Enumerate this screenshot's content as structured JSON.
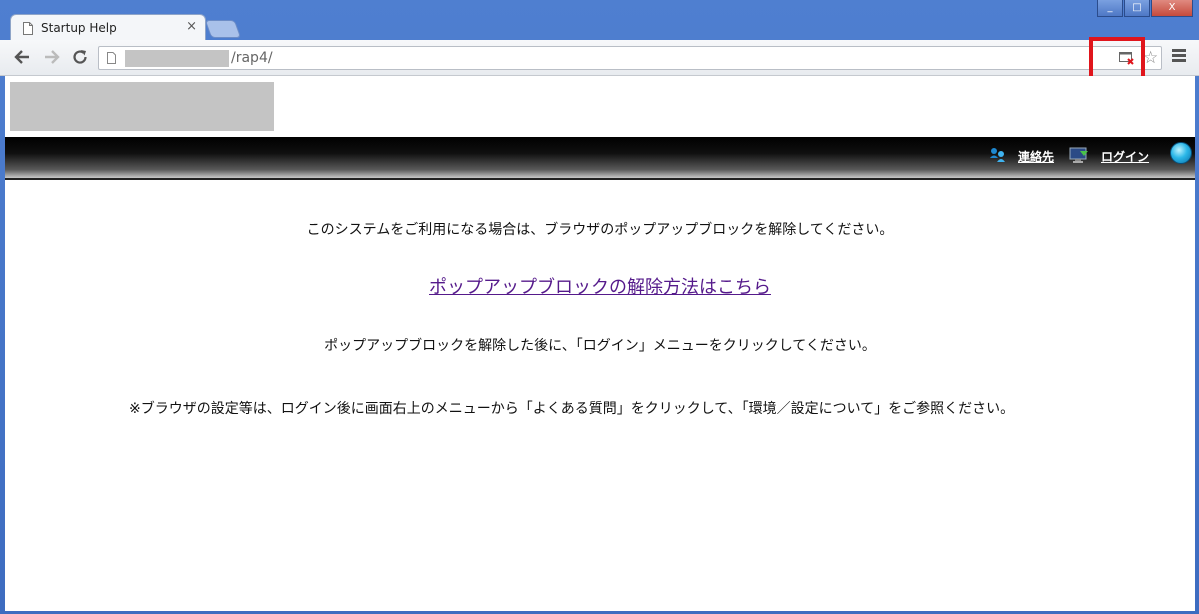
{
  "browser": {
    "tab_title": "Startup Help",
    "tab_close": "×",
    "window_controls": {
      "minimize": "_",
      "maximize": "□",
      "close": "X"
    },
    "address": {
      "visible_path": "/rap4/"
    },
    "icons": [
      "back-arrow-icon",
      "forward-arrow-icon",
      "reload-icon",
      "page-icon",
      "popup-blocked-icon",
      "bookmark-star-icon",
      "menu-icon"
    ]
  },
  "header": {
    "contact_label": "連絡先",
    "login_label": "ログイン"
  },
  "content": {
    "message_1": "このシステムをご利用になる場合は、ブラウザのポップアップブロックを解除してください。",
    "help_link": "ポップアップブロックの解除方法はこちら",
    "message_2": "ポップアップブロックを解除した後に、「ログイン」メニューをクリックしてください。",
    "note": "※ブラウザの設定等は、ログイン後に画面右上のメニューから「よくある質問」をクリックして、「環境／設定について」をご参照ください。"
  },
  "colors": {
    "highlight": "#e0151c",
    "link": "#551a8b",
    "chrome_frame": "#4f7fd0"
  }
}
